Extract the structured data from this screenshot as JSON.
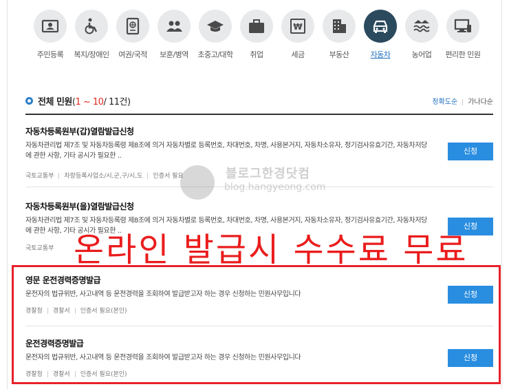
{
  "categories": [
    {
      "label": "주민등록",
      "icon": "id-card-icon",
      "active": false
    },
    {
      "label": "복지/장애인",
      "icon": "wheelchair-icon",
      "active": false
    },
    {
      "label": "여권/국적",
      "icon": "passport-icon",
      "active": false
    },
    {
      "label": "보훈/병역",
      "icon": "people-icon",
      "active": false
    },
    {
      "label": "초중고/대학",
      "icon": "graduation-cap-icon",
      "active": false
    },
    {
      "label": "취업",
      "icon": "briefcase-icon",
      "active": false
    },
    {
      "label": "세금",
      "icon": "won-tax-icon",
      "active": false
    },
    {
      "label": "부동산",
      "icon": "building-icon",
      "active": false
    },
    {
      "label": "자동차",
      "icon": "car-icon",
      "active": true
    },
    {
      "label": "농어업",
      "icon": "waves-icon",
      "active": false
    },
    {
      "label": "편리한 민원",
      "icon": "monitor-icon",
      "active": false
    }
  ],
  "section": {
    "title": "전체 민원",
    "count_open": "(",
    "count_range": "1 ~ 10",
    "count_close": "/ 11건)",
    "sort_accuracy": "정확도순",
    "sort_alpha": "가나다순"
  },
  "items": [
    {
      "title": "자동차등록원부(갑)열람발급신청",
      "desc": "자동차관리법 제7조 및 자동차등록령 제8조에 의거 자동차별로 등록번호, 차대번호, 차명, 사용본거지, 자동차소유자, 정기검사유효기간, 자동차저당에 관한 사항, 기타 공시가 필요한 ..",
      "meta": [
        "국토교통부",
        "차량등록사업소/시,군,구/시,도",
        "인증서 필요"
      ],
      "apply": "신청"
    },
    {
      "title": "자동차등록원부(을)열람발급신청",
      "desc": "자동차관리법 제7조 및 자동차등록령 제8조에 의거 자동차별로 등록번호, 차대번호, 차명, 사용본거지, 자동차소유자, 정기검사유효기간, 자동차저당에 관한 사항, 기타 공시가 필요한 ..",
      "meta": [
        "국토교통부",
        "",
        ""
      ],
      "apply": "신청"
    },
    {
      "title": "영문 운전경력증명발급",
      "desc": "운전자의 법규위반, 사고내역 등 운전경력을 조회하여 발급받고자 하는 경우 신청하는 민원사무입니다",
      "meta": [
        "경찰청",
        "경찰서",
        "인증서 필요(본인)"
      ],
      "apply": "신청"
    },
    {
      "title": "운전경력증명발급",
      "desc": "운전자의 법규위반, 사고내역 등 운전경력을 조회하여 발급받고자 하는 경우 신청하는 민원사무입니다",
      "meta": [
        "경찰청",
        "경찰서",
        "인증서 필요(본인)"
      ],
      "apply": "신청"
    }
  ],
  "overlay_text": "온라인 발급시 수수료 무료",
  "watermark": {
    "line1": "블로그한경닷컴",
    "line2": "blog.hangyeong.com"
  },
  "colors": {
    "accent": "#2a8ee0",
    "active_circle": "#2b4a5e",
    "highlight_red": "#e8202a",
    "count_red": "#e0261e"
  }
}
